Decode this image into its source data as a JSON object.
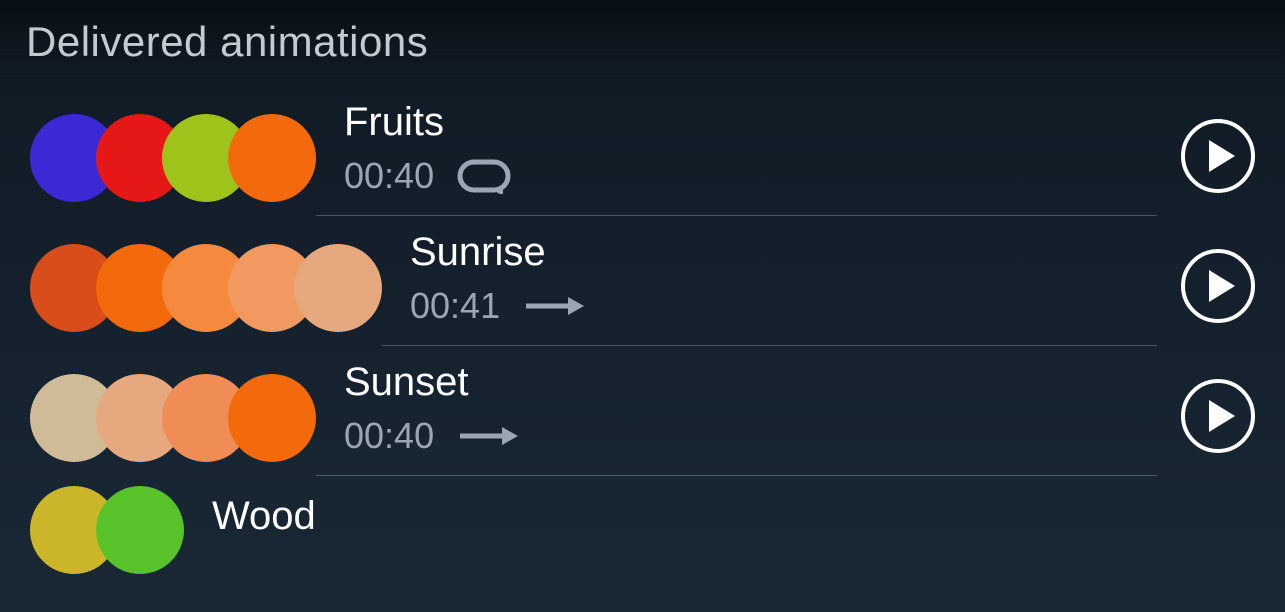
{
  "header": {
    "title": "Delivered animations"
  },
  "animations": [
    {
      "name": "Fruits",
      "duration": "00:40",
      "mode": "loop",
      "colors": [
        "#3b29d6",
        "#e61717",
        "#9ec31b",
        "#f26a0b"
      ]
    },
    {
      "name": "Sunrise",
      "duration": "00:41",
      "mode": "once",
      "colors": [
        "#d84d19",
        "#f26a0b",
        "#f58a3e",
        "#f09a62",
        "#e6a97f"
      ]
    },
    {
      "name": "Sunset",
      "duration": "00:40",
      "mode": "once",
      "colors": [
        "#d0bb98",
        "#e6a97f",
        "#f08d56",
        "#f26a0b"
      ]
    },
    {
      "name": "Wood",
      "duration": "",
      "mode": "",
      "colors": [
        "#cbb62a",
        "#58c22a"
      ]
    }
  ]
}
